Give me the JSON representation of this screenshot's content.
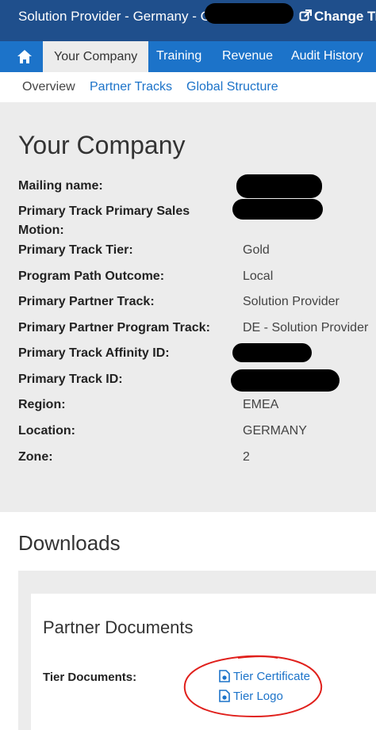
{
  "header": {
    "title": "Solution Provider - Germany - Gold",
    "change_label": "Change Tra"
  },
  "nav": {
    "tabs": [
      {
        "label": "Your Company",
        "active": true
      },
      {
        "label": "Training"
      },
      {
        "label": "Revenue"
      },
      {
        "label": "Audit History"
      }
    ]
  },
  "subnav": {
    "items": [
      "Overview",
      "Partner Tracks",
      "Global Structure"
    ]
  },
  "company": {
    "heading": "Your Company",
    "fields": [
      {
        "label": "Mailing name:",
        "value": ""
      },
      {
        "label": "Primary Track Primary Sales Motion:",
        "value": ""
      },
      {
        "label": "Primary Track Tier:",
        "value": "Gold"
      },
      {
        "label": "Program Path Outcome:",
        "value": "Local"
      },
      {
        "label": "Primary Partner Track:",
        "value": "Solution Provider"
      },
      {
        "label": "Primary Partner Program Track:",
        "value": "DE - Solution Provider"
      },
      {
        "label": "Primary Track Affinity ID:",
        "value": ""
      },
      {
        "label": "Primary Track ID:",
        "value": ""
      },
      {
        "label": "Region:",
        "value": "EMEA"
      },
      {
        "label": "Location:",
        "value": "GERMANY"
      },
      {
        "label": "Zone:",
        "value": "2"
      }
    ]
  },
  "downloads": {
    "heading": "Downloads",
    "section_title": "Partner Documents",
    "tier_label": "Tier Documents:",
    "links": [
      "Tier Certificate",
      "Tier Logo"
    ]
  },
  "colors": {
    "header_bg": "#1f4f8c",
    "nav_bg": "#1c73c9",
    "link": "#1c73c9",
    "panel_bg": "#ececec",
    "annotation": "#e0201c"
  }
}
